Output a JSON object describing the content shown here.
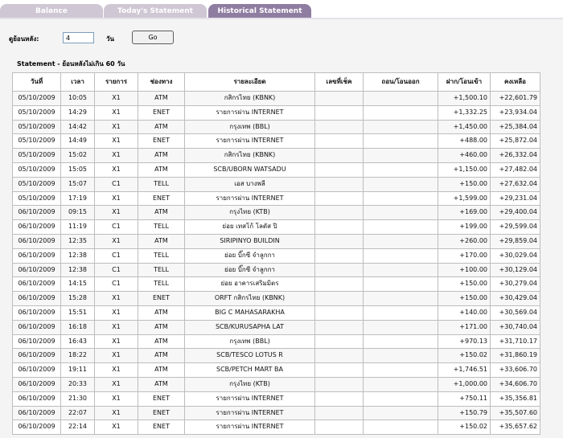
{
  "tabs": [
    {
      "label": "Balance",
      "active": false
    },
    {
      "label": "Today's Statement",
      "active": false
    },
    {
      "label": "Historical Statement",
      "active": true
    }
  ],
  "form": {
    "days_back_label": "ดูย้อนหลัง:",
    "days_value": "4",
    "days_unit": "วัน",
    "go_label": "Go"
  },
  "statement_title": "Statement - ย้อนหลังไม่เกิน 60 วัน",
  "colors": {
    "tab_active": "#8f7da1",
    "tab_inactive": "#cfc7d4",
    "row_alt": "#f7f7f7"
  },
  "table": {
    "columns": [
      "วันที่",
      "เวลา",
      "รายการ",
      "ช่องทาง",
      "รายละเอียด",
      "เลขที่เช็ค",
      "ถอน/โอนออก",
      "ฝาก/โอนเข้า",
      "คงเหลือ"
    ],
    "rows": [
      [
        "05/10/2009",
        "10:05",
        "X1",
        "ATM",
        "กสิกรไทย (KBNK)",
        "",
        "",
        "+1,500.10",
        "+22,601.79"
      ],
      [
        "05/10/2009",
        "14:29",
        "X1",
        "ENET",
        "รายการผ่าน INTERNET",
        "",
        "",
        "+1,332.25",
        "+23,934.04"
      ],
      [
        "05/10/2009",
        "14:42",
        "X1",
        "ATM",
        "กรุงเทพ (BBL)",
        "",
        "",
        "+1,450.00",
        "+25,384.04"
      ],
      [
        "05/10/2009",
        "14:49",
        "X1",
        "ENET",
        "รายการผ่าน INTERNET",
        "",
        "",
        "+488.00",
        "+25,872.04"
      ],
      [
        "05/10/2009",
        "15:02",
        "X1",
        "ATM",
        "กสิกรไทย (KBNK)",
        "",
        "",
        "+460.00",
        "+26,332.04"
      ],
      [
        "05/10/2009",
        "15:05",
        "X1",
        "ATM",
        "SCB/UBORN WATSADU",
        "",
        "",
        "+1,150.00",
        "+27,482.04"
      ],
      [
        "05/10/2009",
        "15:07",
        "C1",
        "TELL",
        "เอส บางพลี",
        "",
        "",
        "+150.00",
        "+27,632.04"
      ],
      [
        "05/10/2009",
        "17:19",
        "X1",
        "ENET",
        "รายการผ่าน INTERNET",
        "",
        "",
        "+1,599.00",
        "+29,231.04"
      ],
      [
        "06/10/2009",
        "09:15",
        "X1",
        "ATM",
        "กรุงไทย (KTB)",
        "",
        "",
        "+169.00",
        "+29,400.04"
      ],
      [
        "06/10/2009",
        "11:19",
        "C1",
        "TELL",
        "ย่อย เทสโก้ โลตัส ปิ",
        "",
        "",
        "+199.00",
        "+29,599.04"
      ],
      [
        "06/10/2009",
        "12:35",
        "X1",
        "ATM",
        "SIRIPINYO BUILDIN",
        "",
        "",
        "+260.00",
        "+29,859.04"
      ],
      [
        "06/10/2009",
        "12:38",
        "C1",
        "TELL",
        "ย่อย บิ๊กซี จำลูกกา",
        "",
        "",
        "+170.00",
        "+30,029.04"
      ],
      [
        "06/10/2009",
        "12:38",
        "C1",
        "TELL",
        "ย่อย บิ๊กซี จำลูกกา",
        "",
        "",
        "+100.00",
        "+30,129.04"
      ],
      [
        "06/10/2009",
        "14:15",
        "C1",
        "TELL",
        "ย่อย อาคารเสริมมิตร",
        "",
        "",
        "+150.00",
        "+30,279.04"
      ],
      [
        "06/10/2009",
        "15:28",
        "X1",
        "ENET",
        "ORFT กสิกรไทย (KBNK)",
        "",
        "",
        "+150.00",
        "+30,429.04"
      ],
      [
        "06/10/2009",
        "15:51",
        "X1",
        "ATM",
        "BIG C MAHASARAKHA",
        "",
        "",
        "+140.00",
        "+30,569.04"
      ],
      [
        "06/10/2009",
        "16:18",
        "X1",
        "ATM",
        "SCB/KURUSAPHA LAT",
        "",
        "",
        "+171.00",
        "+30,740.04"
      ],
      [
        "06/10/2009",
        "16:43",
        "X1",
        "ATM",
        "กรุงเทพ (BBL)",
        "",
        "",
        "+970.13",
        "+31,710.17"
      ],
      [
        "06/10/2009",
        "18:22",
        "X1",
        "ATM",
        "SCB/TESCO LOTUS R",
        "",
        "",
        "+150.02",
        "+31,860.19"
      ],
      [
        "06/10/2009",
        "19:11",
        "X1",
        "ATM",
        "SCB/PETCH MART BA",
        "",
        "",
        "+1,746.51",
        "+33,606.70"
      ],
      [
        "06/10/2009",
        "20:33",
        "X1",
        "ATM",
        "กรุงไทย (KTB)",
        "",
        "",
        "+1,000.00",
        "+34,606.70"
      ],
      [
        "06/10/2009",
        "21:30",
        "X1",
        "ENET",
        "รายการผ่าน INTERNET",
        "",
        "",
        "+750.11",
        "+35,356.81"
      ],
      [
        "06/10/2009",
        "22:07",
        "X1",
        "ENET",
        "รายการผ่าน INTERNET",
        "",
        "",
        "+150.79",
        "+35,507.60"
      ],
      [
        "06/10/2009",
        "22:14",
        "X1",
        "ENET",
        "รายการผ่าน INTERNET",
        "",
        "",
        "+150.02",
        "+35,657.62"
      ]
    ]
  }
}
